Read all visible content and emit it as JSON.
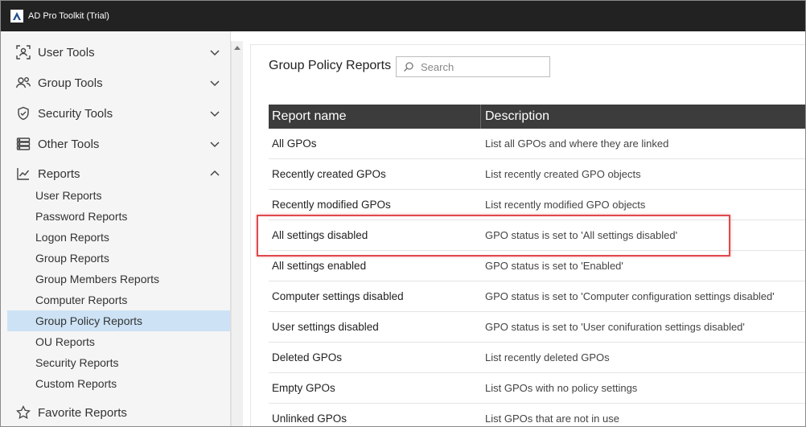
{
  "window": {
    "title": "AD Pro Toolkit (Trial)"
  },
  "sidebar": {
    "groups": [
      {
        "label": "User Tools",
        "icon": "user-scan-icon",
        "expanded": false
      },
      {
        "label": "Group Tools",
        "icon": "group-icon",
        "expanded": false
      },
      {
        "label": "Security Tools",
        "icon": "shield-icon",
        "expanded": false
      },
      {
        "label": "Other Tools",
        "icon": "server-icon",
        "expanded": false
      },
      {
        "label": "Reports",
        "icon": "chart-icon",
        "expanded": true
      }
    ],
    "report_items": [
      "User Reports",
      "Password Reports",
      "Logon Reports",
      "Group Reports",
      "Group Members Reports",
      "Computer Reports",
      "Group Policy Reports",
      "OU Reports",
      "Security Reports",
      "Custom Reports"
    ],
    "selected_item": "Group Policy Reports",
    "favorites": {
      "label": "Favorite Reports",
      "icon": "star-icon"
    }
  },
  "main": {
    "title": "Group Policy Reports",
    "search": {
      "placeholder": "Search",
      "value": ""
    },
    "table": {
      "columns": [
        "Report name",
        "Description"
      ],
      "rows": [
        [
          "All GPOs",
          "List all GPOs and where they are linked"
        ],
        [
          "Recently created GPOs",
          "List recently created GPO objects"
        ],
        [
          "Recently modified GPOs",
          "List recently modified GPO objects"
        ],
        [
          "All settings disabled",
          "GPO status is set to 'All settings disabled'"
        ],
        [
          "All settings enabled",
          "GPO status is set to 'Enabled'"
        ],
        [
          "Computer settings disabled",
          "GPO status is set to 'Computer configuration settings disabled'"
        ],
        [
          "User settings disabled",
          "GPO status is set to 'User conifuration settings disabled'"
        ],
        [
          "Deleted GPOs",
          "List recently deleted GPOs"
        ],
        [
          "Empty GPOs",
          "List GPOs with no policy settings"
        ],
        [
          "Unlinked GPOs",
          "List GPOs that are not in use"
        ]
      ],
      "highlighted_row": "All settings disabled"
    }
  },
  "colors": {
    "titlebar": "#222222",
    "table_header": "#3c3c3c",
    "selected_nav": "#cde3f5",
    "highlight_border": "#e0494c"
  }
}
